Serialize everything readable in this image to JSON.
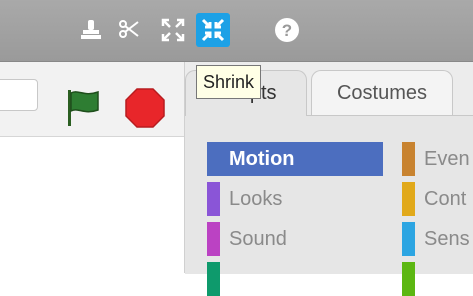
{
  "toolbar": {
    "tools": [
      {
        "name": "duplicate-icon"
      },
      {
        "name": "cut-icon"
      },
      {
        "name": "grow-icon"
      },
      {
        "name": "shrink-icon",
        "active": true
      },
      {
        "name": "help-icon"
      }
    ],
    "tooltip": "Shrink"
  },
  "stage": {
    "green_flag_color": "#2e7d32",
    "stop_color": "#e8262a"
  },
  "tabs": {
    "scripts": "Scripts",
    "costumes": "Costumes"
  },
  "palette": {
    "left": [
      {
        "label": "Motion",
        "color": "#4c6ebf",
        "selected": true
      },
      {
        "label": "Looks",
        "color": "#8a55d7"
      },
      {
        "label": "Sound",
        "color": "#bb42c3"
      },
      {
        "label": "",
        "color": "#0e9a6c"
      }
    ],
    "right": [
      {
        "label": "Even",
        "color": "#c88330"
      },
      {
        "label": "Cont",
        "color": "#e1a91a"
      },
      {
        "label": "Sens",
        "color": "#2ca5e2"
      },
      {
        "label": "",
        "color": "#5cb712"
      }
    ]
  }
}
